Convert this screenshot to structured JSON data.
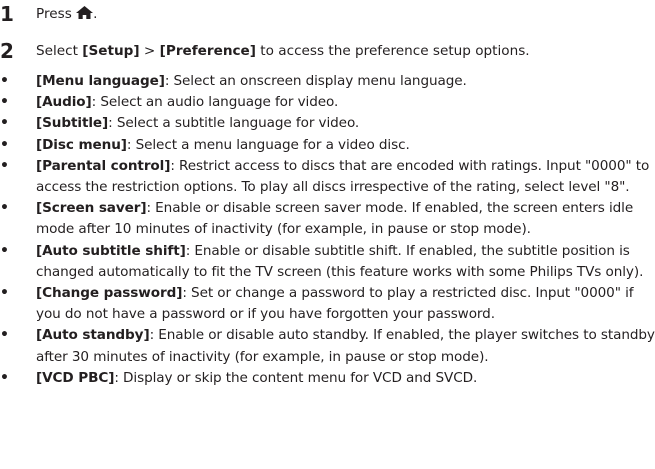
{
  "steps": [
    {
      "number": "1",
      "text_before": "Press ",
      "icon": "home-icon",
      "text_after": "."
    },
    {
      "number": "2",
      "text_parts": [
        {
          "text": "Select ",
          "bold": false
        },
        {
          "text": "[Setup]",
          "bold": true
        },
        {
          "text": " > ",
          "bold": false
        },
        {
          "text": "[Preference]",
          "bold": true
        },
        {
          "text": " to access the preference setup options.",
          "bold": false
        }
      ]
    }
  ],
  "bullet_char": "•",
  "options": [
    {
      "term": "[Menu language]",
      "desc": ": Select an onscreen display menu language."
    },
    {
      "term": "[Audio]",
      "desc": ": Select an audio language for video."
    },
    {
      "term": "[Subtitle]",
      "desc": ": Select a subtitle language for video."
    },
    {
      "term": "[Disc menu]",
      "desc": ": Select a menu language for a video disc."
    },
    {
      "term": "[Parental control]",
      "desc": ": Restrict access to discs that are encoded with ratings. Input \"0000\" to access the restriction options. To play all discs irrespective of the rating, select level \"8\"."
    },
    {
      "term": "[Screen saver]",
      "desc": ": Enable or disable screen saver mode. If enabled, the screen enters idle mode after 10 minutes of inactivity (for example, in pause or stop mode)."
    },
    {
      "term": "[Auto subtitle shift]",
      "desc": ": Enable or disable subtitle shift. If enabled, the subtitle position is changed automatically to fit the TV screen (this feature works with some Philips TVs only)."
    },
    {
      "term": "[Change password]",
      "desc": ": Set or change a password to play a restricted disc. Input \"0000\" if you do not have a password or if you have forgotten your password."
    },
    {
      "term": "[Auto standby]",
      "desc": ": Enable or disable auto standby. If enabled, the player switches to standby after 30 minutes of inactivity (for example, in pause or stop mode)."
    },
    {
      "term": "[VCD PBC]",
      "desc": ": Display or skip the content menu for VCD and SVCD."
    }
  ]
}
